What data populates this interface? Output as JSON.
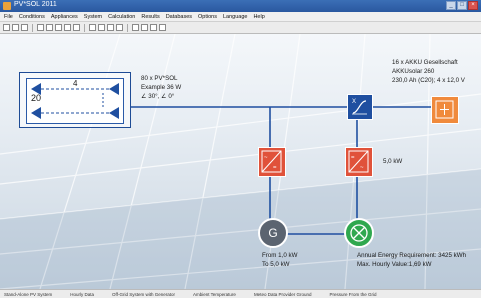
{
  "window": {
    "title": "PV*SOL 2011"
  },
  "menu": [
    "File",
    "Conditions",
    "Appliances",
    "System",
    "Calculation",
    "Results",
    "Databases",
    "Options",
    "Language",
    "Help"
  ],
  "toolbar_icons": [
    "new-icon",
    "open-icon",
    "save-icon",
    "print-icon",
    "cut-icon",
    "copy-icon",
    "paste-icon",
    "undo-icon",
    "chart-icon",
    "table-icon",
    "calc-icon",
    "sum-icon",
    "help-icon",
    "info-icon",
    "settings-icon",
    "pointer-icon"
  ],
  "pv_array": {
    "modules_in_string": "4",
    "strings": "20",
    "line1": "80 x PV*SOL",
    "line2": "Example 36 W",
    "line3": "∠ 30°, ∠ 0°"
  },
  "battery": {
    "line1": "16 x AKKU Gesellschaft",
    "line2": "AKKUsolar 260",
    "line3": "230,0 Ah (C20); 4 x 12,0 V"
  },
  "inverter_right": {
    "label": "5,0 kW"
  },
  "generator": {
    "line1": "From 1,0 kW",
    "line2": "To 5,0 kW"
  },
  "consumer": {
    "line1": "Annual Energy Requirement: 3425 kWh",
    "line2": "Max. Hourly Value:1,69 kW"
  },
  "status": {
    "items": [
      "Stand-Alone PV System",
      "Hourly Data",
      "Off-Grid System with Generator",
      "Ambient Temperature",
      "Meteo Data Provider Ground",
      "Pressure From the Grid"
    ]
  },
  "colors": {
    "line": "#1f4fa0",
    "inverter": "#e0523a",
    "battery": "#f08a3c",
    "generator": "#5b6470",
    "consumer": "#2fa84f",
    "charger": "#1f4fa0"
  }
}
